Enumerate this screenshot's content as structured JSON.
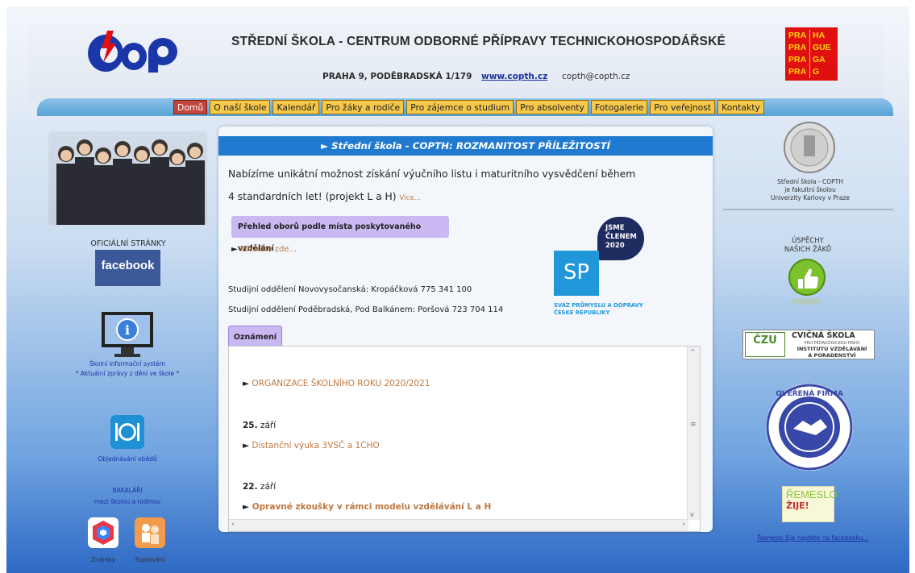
{
  "header": {
    "title": "STŘEDNÍ ŠKOLA - CENTRUM ODBORNÉ PŘÍPRAVY TECHNICKOHOSPODÁŘSKÉ",
    "address": "PRAHA 9, PODĚBRADSKÁ 1/179",
    "website": "www.copth.cz",
    "email": "copth@copth.cz",
    "praha_logo": {
      "left": [
        "PRA",
        "PRA",
        "PRA",
        "PRA"
      ],
      "right": [
        "HA",
        "GUE",
        "GA",
        "G"
      ]
    }
  },
  "nav": {
    "items": [
      {
        "label": "Domů",
        "active": true
      },
      {
        "label": "O naší škole"
      },
      {
        "label": "Kalendář"
      },
      {
        "label": "Pro žáky a rodiče"
      },
      {
        "label": "Pro zájemce o studium"
      },
      {
        "label": "Pro absolventy"
      },
      {
        "label": "Fotogalerie"
      },
      {
        "label": "Pro veřejnost"
      },
      {
        "label": "Kontakty"
      }
    ]
  },
  "left": {
    "official": "OFICIÁLNÍ STRÁNKY",
    "facebook": "facebook",
    "sis_line1": "Školní informační systém",
    "sis_line2": "* Aktuální zprávy z dění ve škole *",
    "lunch": "Objednávání obědů",
    "bakalari1": "BAKALÁŘI",
    "bakalari2": "mezi školou a rodinou",
    "grades": "Známky",
    "substitution": "Suplování"
  },
  "main": {
    "headline": "► Střední škola - COPTH: ROZMANITOST PŘÍLEŽITOSTÍ",
    "intro_line1": "Nabízíme unikátní možnost získání výučního listu i maturitního vysvědčení během",
    "intro_line2": "4 standardních let! (projekt L a H)",
    "more": "Více...",
    "overview_button": "Přehled oborů podle místa poskytovaného vzdělání",
    "click_here": "klikněte zde...",
    "study1": "Studijní oddělení Novovysočanská: Kropáčková 775 341 100",
    "study2": "Studijní oddělení Poděbradská, Pod Balkánem: Poršová 723 704 114",
    "sp_badge": [
      "JSME",
      "ČLENEM",
      "2020"
    ],
    "sp_logo": "SP",
    "sp_text1": "SVAZ PRŮMYSLU A DOPRAVY",
    "sp_text2": "ČESKÉ REPUBLIKY",
    "tab": "Oznámení",
    "news": [
      {
        "date": "",
        "text": "ORGANIZACE ŠKOLNÍHO ROKU 2020/2021",
        "bold": false
      },
      {
        "day": "25.",
        "month": "září",
        "text": "Distanční výuka 3VSČ a 1CHO",
        "bold": false
      },
      {
        "day": "22.",
        "month": "září",
        "text": "Opravné zkoušky v rámci modelu vzdělávání L a H",
        "bold": true
      }
    ]
  },
  "right": {
    "univ1": "Střední škola - COPTH",
    "univ2": "je fakultní školou",
    "univ3": "Univerzity Karlovy v Praze",
    "success1": "ÚSPĚCHY",
    "success2": "NAŠICH ŽÁKŮ",
    "cvicna_title": "CVIČNÁ ŠKOLA",
    "cvicna_l1": "PRO PEDAGOGICKOU PRAXI",
    "cvicna_l2": "INSTITUTU VZDĚLÁVÁNÍ",
    "cvicna_l3": "A PORADENSTVÍ",
    "cvicna_badge": "ČZU",
    "seal_text": "OVĚŘENÁ FIRMA",
    "remeslo_a": "ŘEMESLO",
    "remeslo_b": "ŽIJE!",
    "fb_link": "Řemeslo žije najdete na facebooku..."
  }
}
